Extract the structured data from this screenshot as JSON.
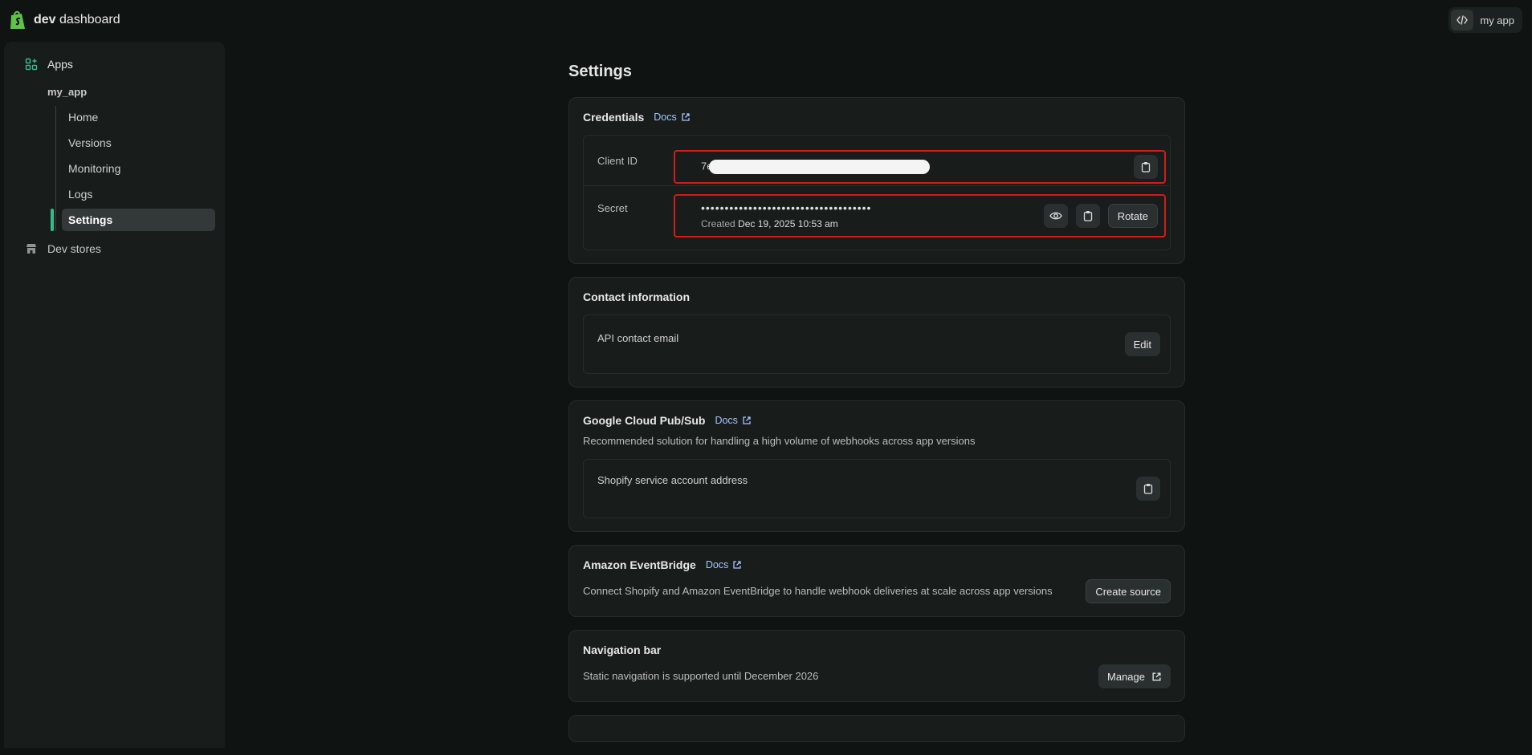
{
  "brand": {
    "bold": "dev",
    "rest": " dashboard"
  },
  "app_switcher": {
    "label": "my app"
  },
  "sidebar": {
    "apps_label": "Apps",
    "app_name": "my_app",
    "items": [
      {
        "label": "Home"
      },
      {
        "label": "Versions"
      },
      {
        "label": "Monitoring"
      },
      {
        "label": "Logs"
      },
      {
        "label": "Settings",
        "active": true
      }
    ],
    "dev_stores_label": "Dev stores"
  },
  "page": {
    "title": "Settings"
  },
  "credentials": {
    "title": "Credentials",
    "docs": "Docs",
    "client_id_label": "Client ID",
    "client_id_prefix": "7e",
    "secret_label": "Secret",
    "secret_value": "••••••••••••••••••••••••••••••••••••",
    "created_prefix": "Created",
    "created_date": "Dec 19, 2025 10:53 am",
    "rotate_label": "Rotate"
  },
  "contact": {
    "title": "Contact information",
    "field_label": "API contact email",
    "edit_label": "Edit"
  },
  "pubsub": {
    "title": "Google Cloud Pub/Sub",
    "docs": "Docs",
    "description": "Recommended solution for handling a high volume of webhooks across app versions",
    "field_label": "Shopify service account address"
  },
  "eventbridge": {
    "title": "Amazon EventBridge",
    "docs": "Docs",
    "description": "Connect Shopify and Amazon EventBridge to handle webhook deliveries at scale across app versions",
    "button_label": "Create source"
  },
  "navbar": {
    "title": "Navigation bar",
    "description": "Static navigation is supported until December 2026",
    "button_label": "Manage"
  },
  "colors": {
    "accent": "#2fbf8f",
    "highlight_border": "#d01c1c",
    "link": "#a8c4ff"
  }
}
